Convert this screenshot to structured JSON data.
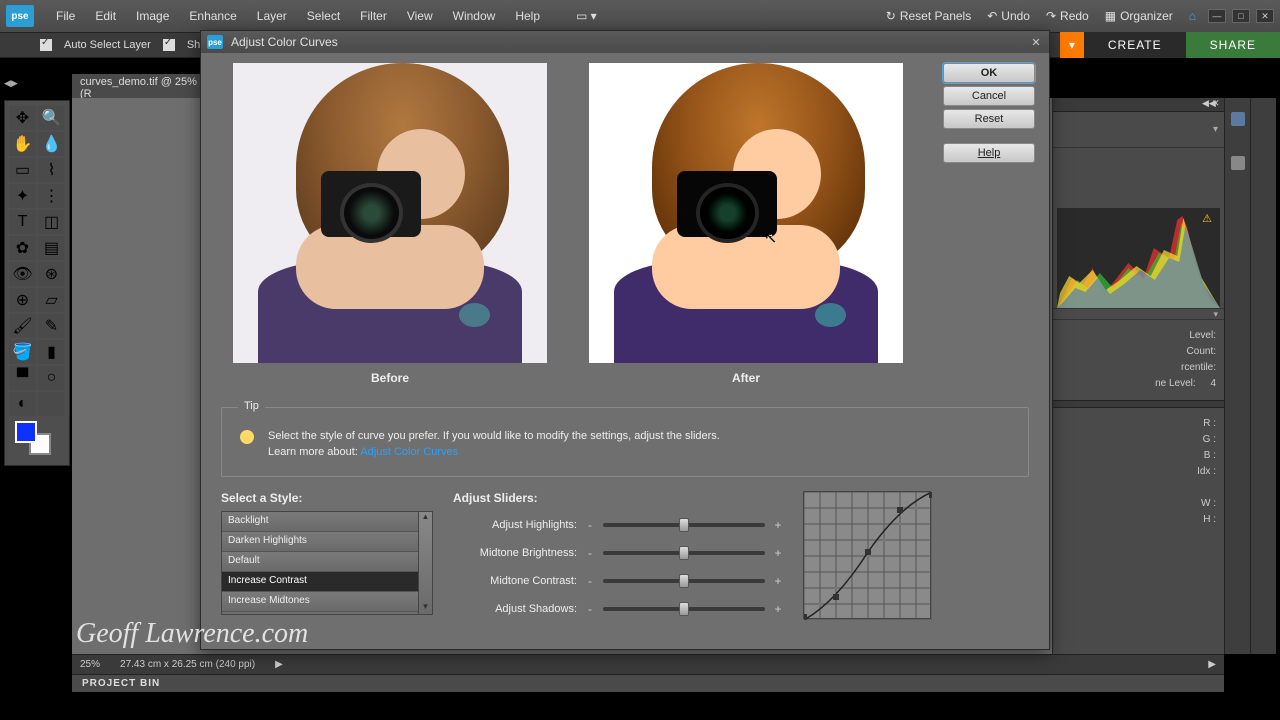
{
  "app": {
    "logo": "pse"
  },
  "menu": [
    "File",
    "Edit",
    "Image",
    "Enhance",
    "Layer",
    "Select",
    "Filter",
    "View",
    "Window",
    "Help"
  ],
  "menu_right": {
    "reset": "Reset Panels",
    "undo": "Undo",
    "redo": "Redo",
    "organizer": "Organizer"
  },
  "optbar": {
    "auto_select": "Auto Select Layer",
    "show_bounds": "Show Bou"
  },
  "tabs": {
    "create": "CREATE",
    "share": "SHARE"
  },
  "doc_tab": "curves_demo.tif @ 25% (R",
  "status": {
    "zoom": "25%",
    "dims": "27.43 cm x 26.25 cm (240 ppi)"
  },
  "project_bin": "PROJECT BIN",
  "dialog": {
    "title": "Adjust Color Curves",
    "buttons": {
      "ok": "OK",
      "cancel": "Cancel",
      "reset": "Reset",
      "help": "Help"
    },
    "before": "Before",
    "after": "After",
    "tip_label": "Tip",
    "tip_text": "Select the style of curve you prefer. If you would like to modify the settings, adjust the sliders.",
    "tip_learn": "Learn more about:",
    "tip_link": "Adjust Color Curves",
    "select_style": "Select a Style:",
    "styles": [
      "Backlight",
      "Darken Highlights",
      "Default",
      "Increase Contrast",
      "Increase Midtones"
    ],
    "selected_style_index": 3,
    "adjust_sliders": "Adjust Sliders:",
    "sliders": [
      {
        "label": "Adjust Highlights:",
        "pos": 50
      },
      {
        "label": "Midtone Brightness:",
        "pos": 50
      },
      {
        "label": "Midtone Contrast:",
        "pos": 50
      },
      {
        "label": "Adjust Shadows:",
        "pos": 50
      }
    ]
  },
  "rpanel": {
    "level": "Level:",
    "count": "Count:",
    "percentile": "rcentile:",
    "cache": "ne Level:",
    "cache_val": "4",
    "r": "R :",
    "g": "G :",
    "b": "B :",
    "idx": "Idx :",
    "w": "W :",
    "h": "H :"
  },
  "watermark": "Geoff Lawrence.com"
}
